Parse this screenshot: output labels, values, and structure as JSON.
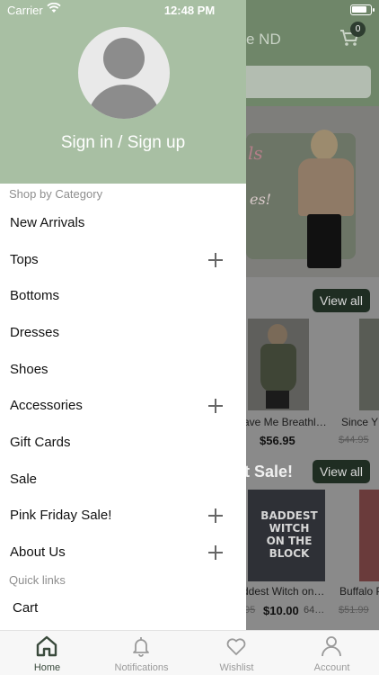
{
  "status_bar": {
    "carrier": "Carrier",
    "time": "12:48 PM"
  },
  "store": {
    "title_fragment": "e ND",
    "cart_count": "0",
    "banner_script": "ls",
    "banner_fragment": "es!",
    "view_all_label": "View all",
    "sale_heading_fragment": "t Sale!",
    "products_row1": [
      {
        "name": "ave Me Breathl…",
        "price": "$56.95",
        "old_price": ""
      },
      {
        "name": "Since Y",
        "price": "",
        "old_price": "$44.95"
      }
    ],
    "products_row2": [
      {
        "name": "ddest Witch on…",
        "price": "$10.00",
        "old_price": "95",
        "extra": "64…"
      },
      {
        "name": "Buffalo P",
        "price": "",
        "old_price": "$51.99"
      }
    ],
    "shirt_print": "BADDEST WITCH ON THE BLOCK"
  },
  "drawer": {
    "sign_in_label": "Sign in / Sign up",
    "category_heading": "Shop by Category",
    "items": [
      {
        "label": "New Arrivals",
        "expandable": false
      },
      {
        "label": "Tops",
        "expandable": true
      },
      {
        "label": "Bottoms",
        "expandable": false
      },
      {
        "label": "Dresses",
        "expandable": false
      },
      {
        "label": "Shoes",
        "expandable": false
      },
      {
        "label": "Accessories",
        "expandable": true
      },
      {
        "label": "Gift Cards",
        "expandable": false
      },
      {
        "label": "Sale",
        "expandable": false
      },
      {
        "label": "Pink Friday Sale!",
        "expandable": true
      },
      {
        "label": "About Us",
        "expandable": true
      }
    ],
    "quick_links_heading": "Quick links",
    "quick_links": [
      {
        "label": "Cart"
      }
    ]
  },
  "tab_bar": {
    "tabs": [
      {
        "label": "Home",
        "icon": "home-icon",
        "active": true
      },
      {
        "label": "Notifications",
        "icon": "bell-icon",
        "active": false
      },
      {
        "label": "Wishlist",
        "icon": "heart-icon",
        "active": false
      },
      {
        "label": "Account",
        "icon": "person-icon",
        "active": false
      }
    ]
  },
  "colors": {
    "drawer_header": "#a8bfa3",
    "accent_dark": "#1f2d22",
    "active_tab": "#3a4a3c"
  }
}
